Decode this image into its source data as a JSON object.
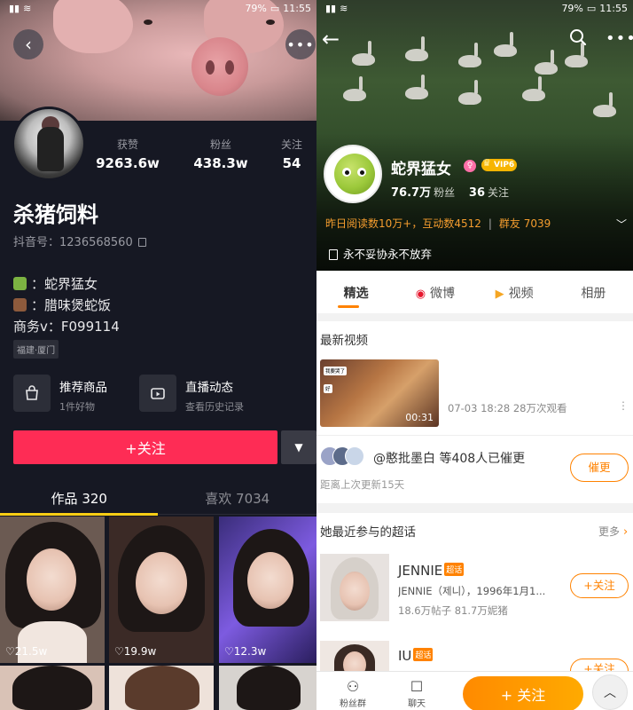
{
  "status_left": {
    "time": "11:55",
    "battery": "79%"
  },
  "status_right": {
    "time": "11:55",
    "battery": "79%"
  },
  "douyin": {
    "stats": [
      {
        "label": "获赞",
        "value": "9263.6w"
      },
      {
        "label": "粉丝",
        "value": "438.3w"
      },
      {
        "label": "关注",
        "value": "54"
      }
    ],
    "name": "杀猪饲料",
    "douyin_id": "抖音号：1236568560",
    "bio": [
      {
        "icon": "snake-emoji-icon",
        "text": "：蛇界猛女"
      },
      {
        "icon": "book-emoji-icon",
        "text": "：腊味煲蛇饭"
      },
      {
        "icon": "",
        "text": "商务v：F099114"
      }
    ],
    "location_tag": "福建·厦门",
    "features": [
      {
        "title": "推荐商品",
        "subtitle": "1件好物"
      },
      {
        "title": "直播动态",
        "subtitle": "查看历史记录"
      }
    ],
    "follow_label": "+关注",
    "tabs": [
      {
        "label": "作品 320"
      },
      {
        "label": "喜欢 7034"
      }
    ],
    "videos": [
      {
        "likes": "21.5w"
      },
      {
        "likes": "19.9w"
      },
      {
        "likes": "12.3w"
      }
    ]
  },
  "weibo": {
    "name": "蛇界猛女",
    "vip_label": "VIP6",
    "fans_count": "76.7万",
    "fans_label": "粉丝",
    "following_count": "36",
    "following_label": "关注",
    "read_stats": "昨日阅读数10万+，互动数4512",
    "group_stats": "群友 7039",
    "motto": "永不妥协永不放弃",
    "tabs": [
      {
        "label": "精选"
      },
      {
        "label": "微博"
      },
      {
        "label": "视频"
      },
      {
        "label": "相册"
      }
    ],
    "latest_video_title": "最新视频",
    "video": {
      "duration": "00:31",
      "meta": "07-03 18:28 28万次观看",
      "bubble1": "我要哭了",
      "bubble2": "好"
    },
    "reminder": {
      "text": "@憨批墨白 等408人已催更",
      "button": "催更",
      "last_update": "距离上次更新15天"
    },
    "topics_title": "她最近参与的超话",
    "more_label": "更多",
    "topics": [
      {
        "name": "JENNIE",
        "badge": "超话",
        "desc": "JENNIE（제니），1996年1月1...",
        "meta": "18.6万帖子 81.7万妮猪",
        "button": "+关注"
      },
      {
        "name": "IU",
        "badge": "超话",
        "desc": "",
        "meta": "",
        "button": "+关注"
      }
    ],
    "bottom_nav": [
      {
        "label": "粉丝群"
      },
      {
        "label": "聊天"
      }
    ],
    "bottom_follow": "+ 关注"
  }
}
